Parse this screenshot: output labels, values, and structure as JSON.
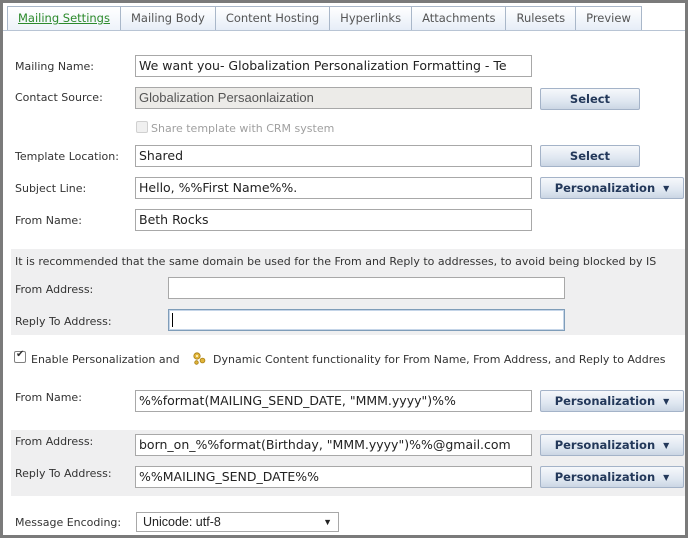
{
  "tabs": [
    {
      "label": "Mailing Settings",
      "active": true
    },
    {
      "label": "Mailing Body",
      "active": false
    },
    {
      "label": "Content Hosting",
      "active": false
    },
    {
      "label": "Hyperlinks",
      "active": false
    },
    {
      "label": "Attachments",
      "active": false
    },
    {
      "label": "Rulesets",
      "active": false
    },
    {
      "label": "Preview",
      "active": false
    }
  ],
  "form": {
    "mailing_name": {
      "label": "Mailing Name:",
      "value": "We want you- Globalization Personalization Formatting - Te"
    },
    "contact_source": {
      "label": "Contact Source:",
      "value": "Globalization Persaonlaization",
      "button": "Select"
    },
    "share_template": {
      "label": "Share template with CRM system",
      "checked": false,
      "disabled": true
    },
    "template_location": {
      "label": "Template Location:",
      "value": "Shared",
      "button": "Select"
    },
    "subject_line": {
      "label": "Subject Line:",
      "value": "Hello, %%First Name%%.",
      "button": "Personalization"
    },
    "from_name": {
      "label": "From Name:",
      "value": "Beth Rocks"
    }
  },
  "domain_panel": {
    "notice": "It is recommended that the same domain be used for the From and Reply to addresses, to avoid being blocked by IS",
    "from_address": {
      "label": "From Address:",
      "value": ""
    },
    "reply_to_address": {
      "label": "Reply To Address:",
      "value": ""
    }
  },
  "personalization": {
    "enable_label_pre": "Enable Personalization and",
    "enable_label_post": "Dynamic Content functionality for From Name, From Address, and Reply to Addres",
    "enabled": true,
    "from_name": {
      "label": "From Name:",
      "value": "%%format(MAILING_SEND_DATE, \"MMM.yyyy\")%%",
      "button": "Personalization"
    },
    "from_address": {
      "label": "From Address:",
      "value": "born_on_%%format(Birthday, \"MMM.yyyy\")%%@gmail.com",
      "button": "Personalization"
    },
    "reply_to_address": {
      "label": "Reply To Address:",
      "value": "%%MAILING_SEND_DATE%%",
      "button": "Personalization"
    }
  },
  "encoding": {
    "label": "Message Encoding:",
    "value": "Unicode: utf-8"
  },
  "icons": {
    "dropdown": "▼",
    "check": "✔"
  }
}
